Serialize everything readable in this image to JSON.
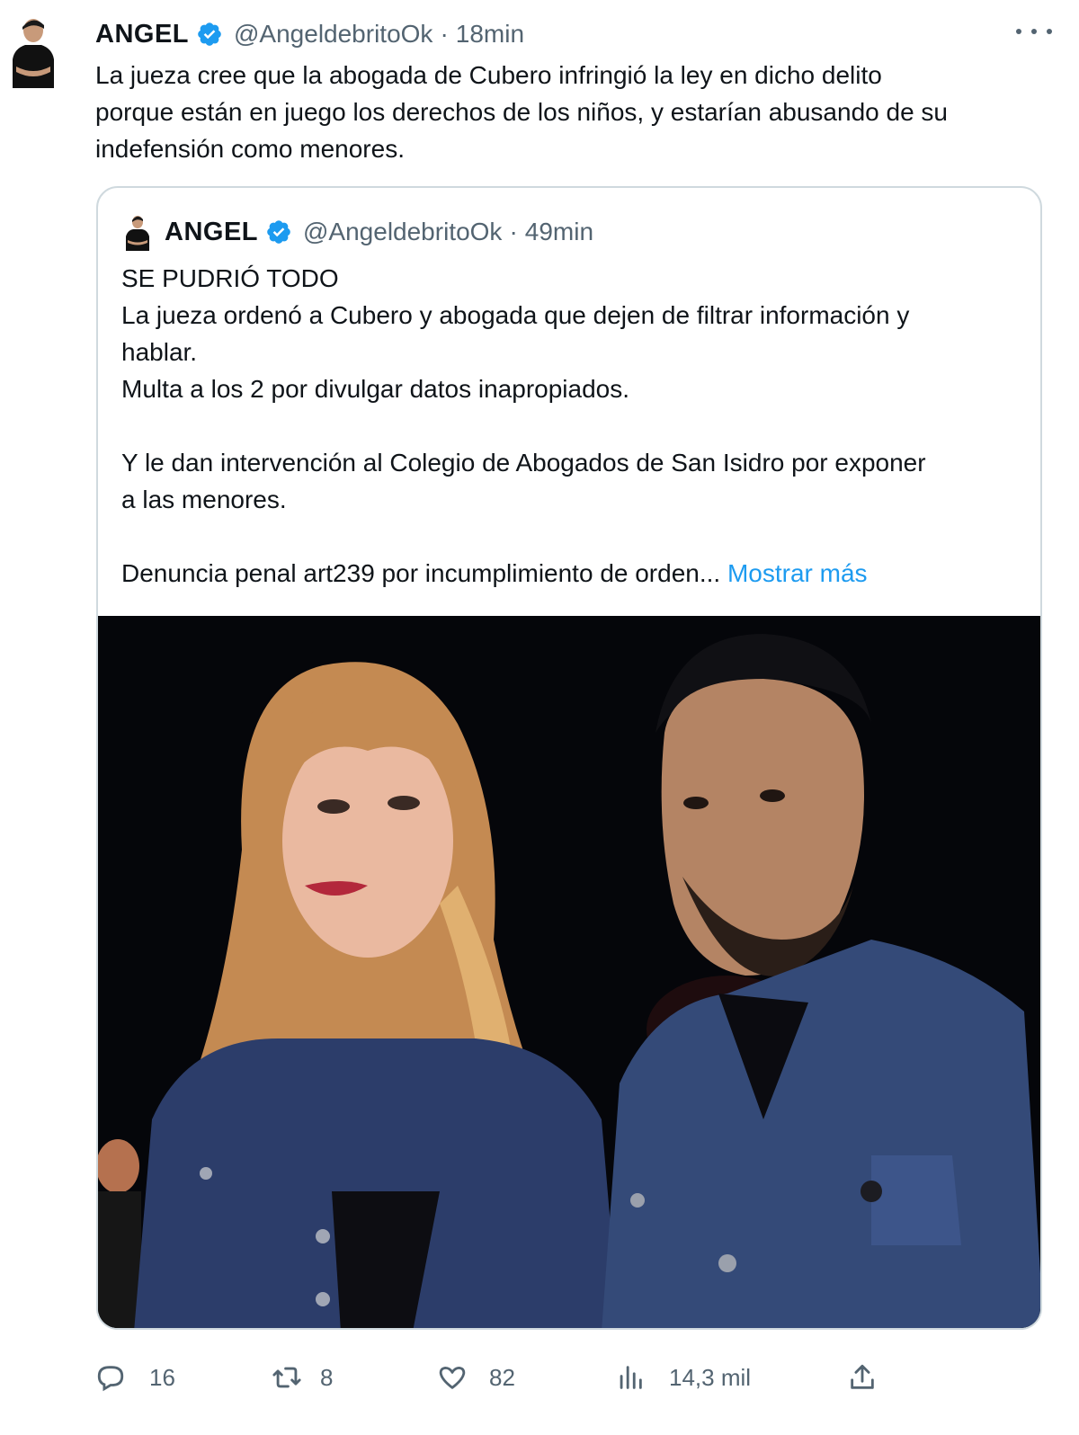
{
  "tweet": {
    "author_name": "ANGEL",
    "handle": "@AngeldebritoOk",
    "separator": "·",
    "time": "18min",
    "lines": [
      "La jueza cree que la abogada de Cubero infringió la ley en dicho delito",
      "porque están en juego los derechos de los niños, y estarían abusando de su",
      "indefensión como menores."
    ]
  },
  "quoted": {
    "author_name": "ANGEL",
    "handle": "@AngeldebritoOk",
    "separator": "·",
    "time": "49min",
    "lines": [
      "SE PUDRIÓ TODO",
      "La jueza ordenó a Cubero y abogada que dejen de filtrar información y",
      "hablar.",
      "Multa a los 2 por divulgar datos inapropiados.",
      "",
      "Y le dan intervención al Colegio de Abogados de San Isidro por exponer",
      "a las menores.",
      "",
      "Denuncia penal art239 por incumplimiento de orden..."
    ],
    "show_more": "Mostrar más"
  },
  "actions": {
    "replies": "16",
    "retweets": "8",
    "likes": "82",
    "views": "14,3 mil"
  },
  "icons": {
    "verified": "verified-badge-icon",
    "more": "more-options-icon",
    "reply": "reply-icon",
    "retweet": "retweet-icon",
    "like": "heart-icon",
    "views": "views-icon",
    "share": "share-icon"
  },
  "colors": {
    "accent": "#1d9bf0",
    "text": "#0f1419",
    "secondary": "#536471",
    "border": "#cfd9de"
  }
}
